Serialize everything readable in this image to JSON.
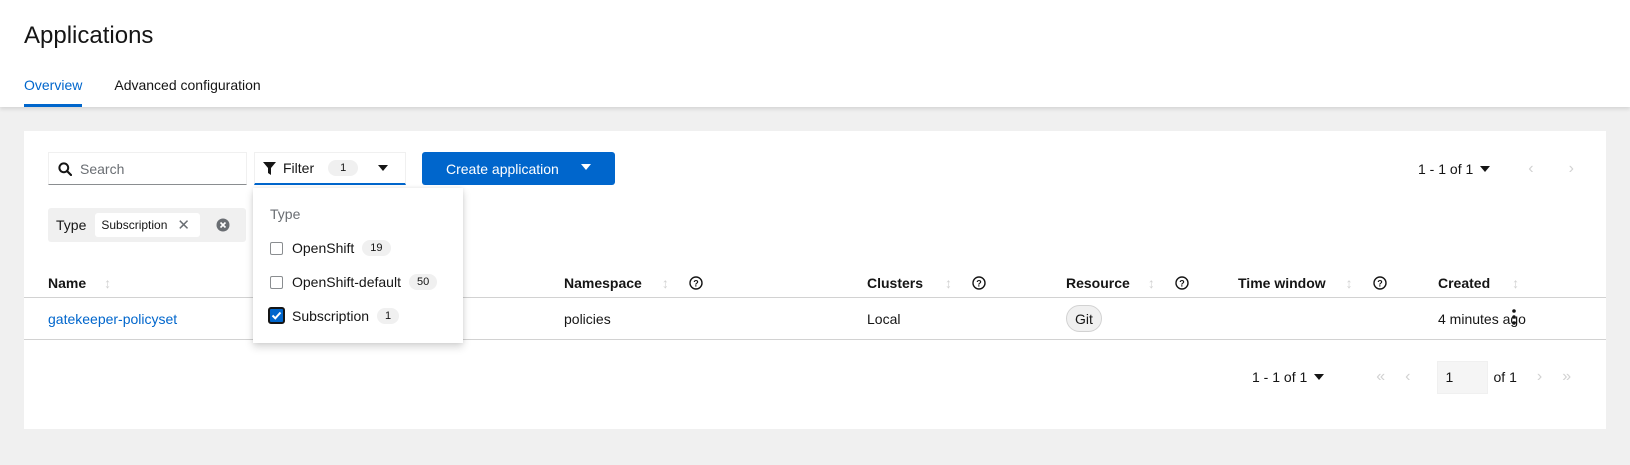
{
  "header": {
    "title": "Applications",
    "tabs": [
      {
        "label": "Overview",
        "active": true
      },
      {
        "label": "Advanced configuration",
        "active": false
      }
    ]
  },
  "toolbar": {
    "search_placeholder": "Search",
    "filter_label": "Filter",
    "filter_count": "1",
    "create_label": "Create application",
    "pagination_top": "1 - 1 of 1",
    "chip_category": "Type",
    "chip_value": "Subscription"
  },
  "filter_menu": {
    "group_title": "Type",
    "options": [
      {
        "label": "OpenShift",
        "count": "19",
        "checked": false
      },
      {
        "label": "OpenShift-default",
        "count": "50",
        "checked": false
      },
      {
        "label": "Subscription",
        "count": "1",
        "checked": true
      }
    ]
  },
  "table": {
    "columns": [
      "Name",
      "Namespace",
      "Clusters",
      "Resource",
      "Time window",
      "Created"
    ],
    "rows": [
      {
        "name": "gatekeeper-policyset",
        "namespace": "policies",
        "clusters": "Local",
        "resource": "Git",
        "time_window": "",
        "created": "4 minutes ago"
      }
    ]
  },
  "pagination_bottom": {
    "range": "1 - 1 of 1",
    "page": "1",
    "of_label": "of 1"
  },
  "colors": {
    "accent": "#0066cc",
    "background": "#f0f0f0"
  }
}
